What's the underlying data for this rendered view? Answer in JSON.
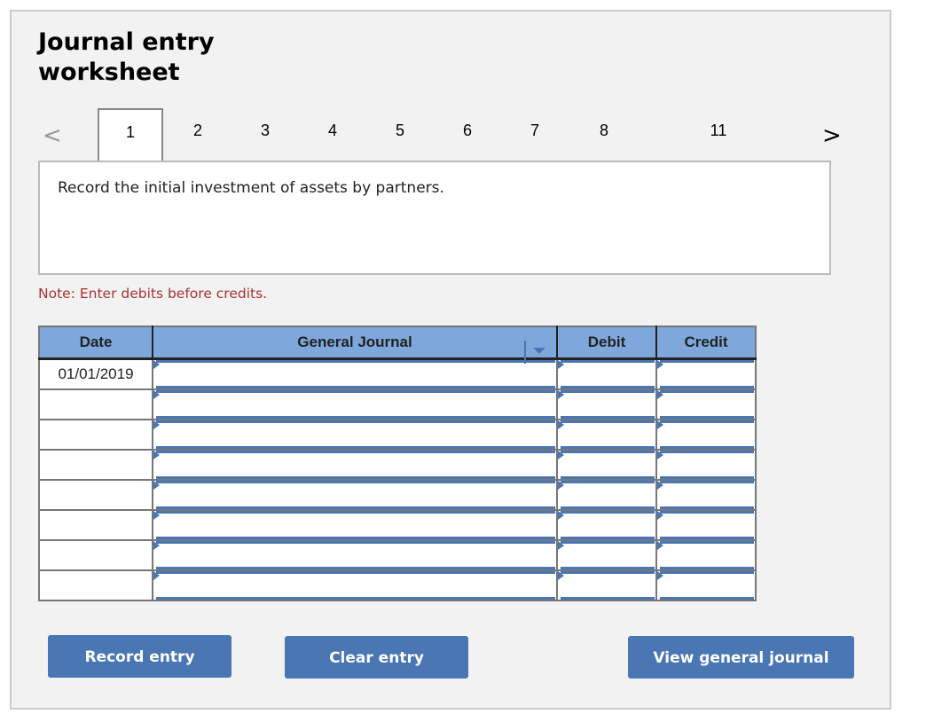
{
  "title_line1": "Journal entry",
  "title_line2": "worksheet",
  "pager": {
    "prev": "<",
    "next": ">",
    "tabs": [
      "1",
      "2",
      "3",
      "4",
      "5",
      "6",
      "7",
      "8",
      "11"
    ],
    "active": "1"
  },
  "prompt": "Record the initial investment of assets by partners.",
  "note": "Note: Enter debits before credits.",
  "table": {
    "headers": [
      "Date",
      "General Journal",
      "Debit",
      "Credit"
    ],
    "rows": [
      {
        "date": "01/01/2019",
        "account": "",
        "debit": "",
        "credit": ""
      },
      {
        "date": "",
        "account": "",
        "debit": "",
        "credit": ""
      },
      {
        "date": "",
        "account": "",
        "debit": "",
        "credit": ""
      },
      {
        "date": "",
        "account": "",
        "debit": "",
        "credit": ""
      },
      {
        "date": "",
        "account": "",
        "debit": "",
        "credit": ""
      },
      {
        "date": "",
        "account": "",
        "debit": "",
        "credit": ""
      },
      {
        "date": "",
        "account": "",
        "debit": "",
        "credit": ""
      },
      {
        "date": "",
        "account": "",
        "debit": "",
        "credit": ""
      }
    ]
  },
  "buttons": {
    "record": "Record entry",
    "clear": "Clear entry",
    "view": "View general journal"
  },
  "colors": {
    "accent": "#4a76b4",
    "header_bg": "#7ea8dc",
    "note": "#a83232"
  }
}
